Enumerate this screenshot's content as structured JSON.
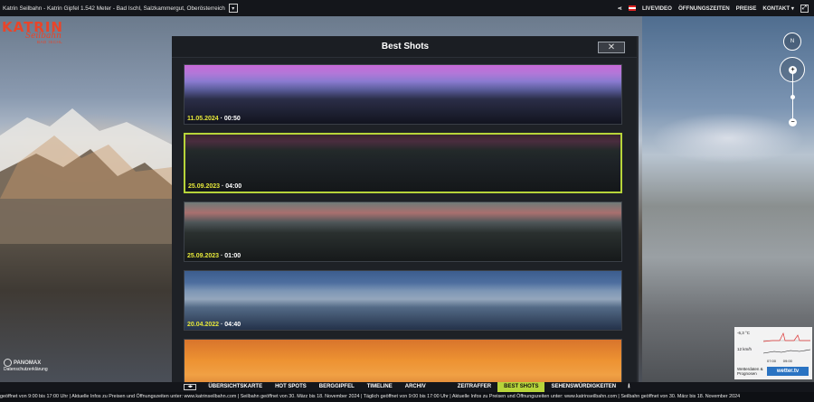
{
  "topbar": {
    "title": "Katrin Seilbahn - Katrin Gipfel 1.542 Meter - Bad Ischl, Salzkammergut, Oberösterreich",
    "nav": [
      "LIVEVIDEO",
      "ÖFFNUNGSZEITEN",
      "PREISE",
      "KONTAKT"
    ]
  },
  "logo": {
    "line1": "KATRIN",
    "line2": "Seilbahn",
    "line3": "BAD ISCHL"
  },
  "panomax": {
    "brand": "PANOMAX",
    "privacy": "Datenschutzerklärung"
  },
  "modal": {
    "title": "Best Shots",
    "close": "✕",
    "shots": [
      {
        "date": "11.05.2024",
        "time": "00:50",
        "selected": false
      },
      {
        "date": "25.09.2023",
        "time": "04:00",
        "selected": true
      },
      {
        "date": "25.09.2023",
        "time": "01:00",
        "selected": false
      },
      {
        "date": "20.04.2022",
        "time": "04:40",
        "selected": false
      },
      {
        "date": "",
        "time": "",
        "selected": false
      }
    ]
  },
  "bottomnav": {
    "items": [
      "ÜBERSICHTSKARTE",
      "HOT SPOTS",
      "BERGGIPFEL",
      "TIMELINE",
      "ARCHIV",
      "ZEITRAFFER",
      "BEST SHOTS",
      "SEHENSWÜRDIGKEITEN"
    ],
    "active": "BEST SHOTS"
  },
  "weather": {
    "temp": "-6,3 °C",
    "wind": "12 km/h",
    "label": "Wetterdaten & Prognosen",
    "brand": "wetter.tv",
    "t1": "07:00",
    "t2": "09:00",
    "axis_top": "20",
    "axis_bottom": "0"
  },
  "ticker": "geöffnet von 9:00 bis 17:00  Uhr  |  Aktuelle Infos zu Preisen und Öffnungszeiten unter: www.katrinseilbahn.com  |  Seilbahn geöffnet von 30. März bis 18. November 2024  |  Täglich geöffnet von 9:00 bis 17:00  Uhr  |  Aktuelle Infos zu Preisen und Öffnungszeiten unter: www.katrinseilbahn.com  |  Seilbahn geöffnet von 30. März bis 18. November 2024",
  "colors": {
    "accent": "#b7d43a",
    "date": "#e4e63a",
    "logo": "#e8452a"
  }
}
